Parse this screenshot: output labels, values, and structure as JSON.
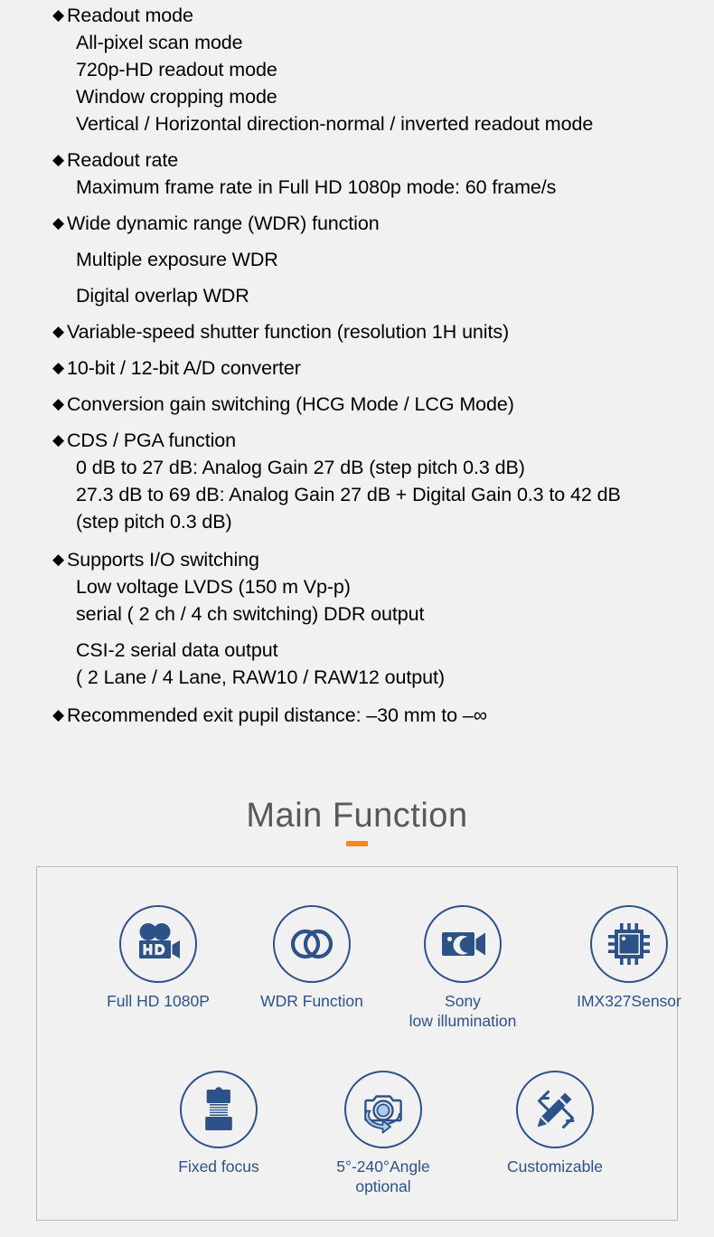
{
  "specs": {
    "groups": [
      {
        "heading": "Readout mode",
        "bullet": "◆",
        "items": [
          "All-pixel scan mode",
          "720p-HD readout mode",
          "Window cropping mode",
          "Vertical / Horizontal direction-normal / inverted readout mode"
        ]
      },
      {
        "heading": "Readout rate",
        "bullet": "◆",
        "items": [
          "Maximum frame rate in Full HD 1080p mode: 60 frame/s"
        ]
      },
      {
        "heading": "Wide dynamic range (WDR) function",
        "bullet": "◆",
        "items": [
          "Multiple exposure WDR",
          "Digital overlap WDR"
        ]
      },
      {
        "heading": "Variable-speed shutter function (resolution 1H units)",
        "bullet": "◆",
        "items": []
      },
      {
        "heading": "10-bit / 12-bit A/D converter",
        "bullet": "◆",
        "items": []
      },
      {
        "heading": "Conversion gain switching (HCG Mode / LCG Mode)",
        "bullet": "◆",
        "items": []
      },
      {
        "heading": "CDS / PGA function",
        "bullet": "◆",
        "items": [
          "0 dB to 27 dB: Analog Gain 27 dB (step pitch 0.3 dB)",
          "27.3 dB to 69 dB: Analog Gain 27 dB + Digital Gain 0.3 to 42 dB (step pitch 0.3 dB)"
        ]
      },
      {
        "heading": "Supports I/O switching",
        "bullet": "◆",
        "items": [
          "Low voltage LVDS (150 m Vp-p)",
          "serial ( 2 ch / 4 ch switching) DDR output",
          "CSI-2 serial data output",
          "( 2 Lane / 4 Lane, RAW10 / RAW12 output)"
        ]
      },
      {
        "heading": "Recommended exit pupil distance: –30 mm to –∞",
        "bullet": "◆",
        "items": []
      }
    ]
  },
  "main_function": {
    "title": "Main Function",
    "accent_color": "#f8881a",
    "title_color": "#595959"
  },
  "features": {
    "accent_color": "#2d5288",
    "light_accent_color": "#a8cdee",
    "row1": [
      {
        "icon": "hd-video-camera-icon",
        "label": "Full HD 1080P",
        "label2": ""
      },
      {
        "icon": "two-overlapping-rings-icon",
        "label": "WDR Function",
        "label2": ""
      },
      {
        "icon": "night-camera-moon-icon",
        "label": "Sony",
        "label2": "low illumination"
      },
      {
        "icon": "microchip-icon",
        "label": "IMX327Sensor",
        "label2": ""
      }
    ],
    "row2": [
      {
        "icon": "lens-barrel-icon",
        "label": "Fixed focus",
        "label2": ""
      },
      {
        "icon": "rotating-camera-angle-icon",
        "label": "5°-240°Angle",
        "label2": "optional"
      },
      {
        "icon": "pencil-edit-icon",
        "label": "Customizable",
        "label2": ""
      }
    ]
  }
}
